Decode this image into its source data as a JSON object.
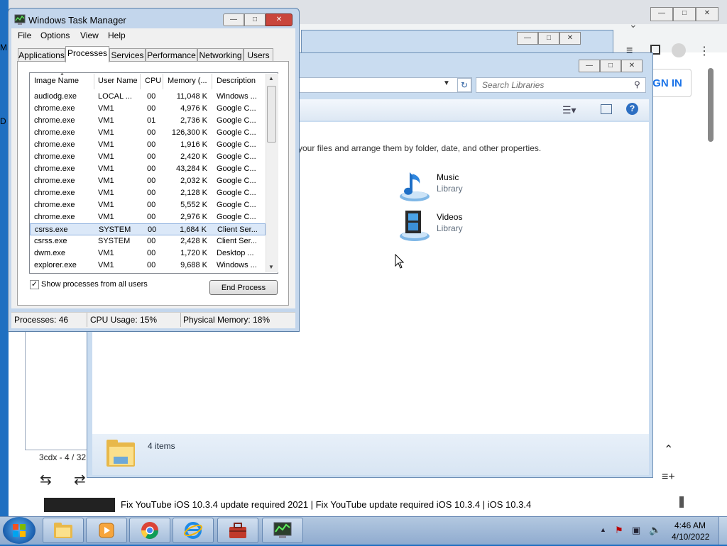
{
  "chrome": {
    "sign_in": "IGN IN",
    "count_text": "3cdx - 4 / 32",
    "video_title": "Fix YouTube iOS 10.3.4 update required 2021 | Fix YouTube update required iOS 10.3.4 | iOS 10.3.4",
    "edge_chars": [
      "M",
      "D"
    ]
  },
  "explorer": {
    "search_placeholder": "Search Libraries",
    "hint": "your files and arrange them by folder, date, and other properties.",
    "libraries": [
      {
        "name": "Music",
        "type": "Library",
        "icon": "music-library-icon"
      },
      {
        "name": "Videos",
        "type": "Library",
        "icon": "videos-library-icon"
      }
    ],
    "items_count": "4 items"
  },
  "task_manager": {
    "title": "Windows Task Manager",
    "menu": [
      "File",
      "Options",
      "View",
      "Help"
    ],
    "tabs": [
      "Applications",
      "Processes",
      "Services",
      "Performance",
      "Networking",
      "Users"
    ],
    "active_tab": "Processes",
    "columns": [
      "Image Name",
      "User Name",
      "CPU",
      "Memory (...",
      "Description"
    ],
    "rows": [
      [
        "audiodg.exe",
        "LOCAL ...",
        "00",
        "11,048 K",
        "Windows ..."
      ],
      [
        "chrome.exe",
        "VM1",
        "00",
        "4,976 K",
        "Google C..."
      ],
      [
        "chrome.exe",
        "VM1",
        "01",
        "2,736 K",
        "Google C..."
      ],
      [
        "chrome.exe",
        "VM1",
        "00",
        "126,300 K",
        "Google C..."
      ],
      [
        "chrome.exe",
        "VM1",
        "00",
        "1,916 K",
        "Google C..."
      ],
      [
        "chrome.exe",
        "VM1",
        "00",
        "2,420 K",
        "Google C..."
      ],
      [
        "chrome.exe",
        "VM1",
        "00",
        "43,284 K",
        "Google C..."
      ],
      [
        "chrome.exe",
        "VM1",
        "00",
        "2,032 K",
        "Google C..."
      ],
      [
        "chrome.exe",
        "VM1",
        "00",
        "2,128 K",
        "Google C..."
      ],
      [
        "chrome.exe",
        "VM1",
        "00",
        "5,552 K",
        "Google C..."
      ],
      [
        "chrome.exe",
        "VM1",
        "00",
        "2,976 K",
        "Google C..."
      ],
      [
        "csrss.exe",
        "SYSTEM",
        "00",
        "1,684 K",
        "Client Ser..."
      ],
      [
        "csrss.exe",
        "SYSTEM",
        "00",
        "2,428 K",
        "Client Ser..."
      ],
      [
        "dwm.exe",
        "VM1",
        "00",
        "1,720 K",
        "Desktop ..."
      ],
      [
        "explorer.exe",
        "VM1",
        "00",
        "9,688 K",
        "Windows ..."
      ]
    ],
    "selected_row": 11,
    "show_all_label": "Show processes from all users",
    "show_all_checked": true,
    "check_mark": "✓",
    "end_process": "End Process",
    "status": {
      "processes": "Processes: 46",
      "cpu": "CPU Usage: 15%",
      "memory": "Physical Memory: 18%"
    }
  },
  "taskbar": {
    "time": "4:46 AM",
    "date": "4/10/2022",
    "pinned": [
      "explorer-icon",
      "media-player-icon",
      "chrome-icon",
      "ie-icon",
      "toolbox-icon",
      "task-manager-icon"
    ]
  }
}
